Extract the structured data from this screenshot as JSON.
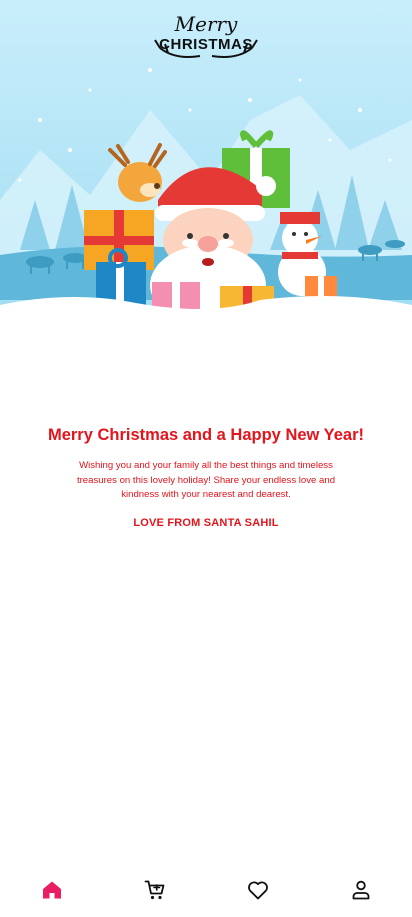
{
  "banner": {
    "logo_script": "Merry",
    "logo_caps": "CHRISTMAS"
  },
  "greeting": {
    "title": "Merry Christmas and a Happy New Year!",
    "message": "Wishing you and your family all the best things and timeless treasures on this lovely holiday! Share your endless love and kindness with your nearest and dearest.",
    "signature": "LOVE FROM SANTA SAHIL"
  },
  "nav": {
    "items": [
      {
        "icon": "home-icon",
        "active": true
      },
      {
        "icon": "cart-icon",
        "active": false
      },
      {
        "icon": "heart-icon",
        "active": false
      },
      {
        "icon": "user-icon",
        "active": false
      }
    ],
    "active_color": "#e91e63",
    "inactive_color": "#111111"
  },
  "colors": {
    "accent": "#e3141c",
    "sky": "#c6ecfa",
    "snow": "#ffffff"
  }
}
